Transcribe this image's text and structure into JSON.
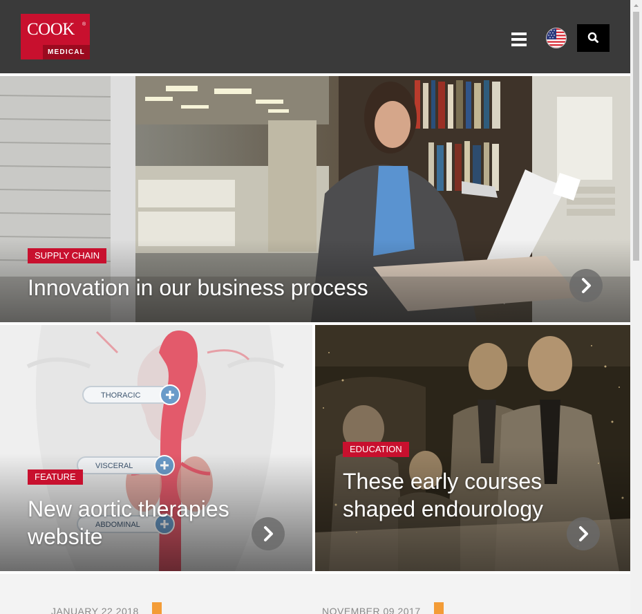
{
  "header": {
    "logo": {
      "word": "COOK",
      "sub": "MEDICAL"
    },
    "menu_icon": "hamburger-icon",
    "language_icon": "us-flag-icon",
    "search_icon": "search-icon"
  },
  "tiles": [
    {
      "tag": "SUPPLY CHAIN",
      "title": "Innovation in our business process",
      "arrow_icon": "chevron-right-icon"
    },
    {
      "tag": "FEATURE",
      "title": "New aortic therapies website",
      "arrow_icon": "chevron-right-icon",
      "diagram_labels": [
        "THORACIC",
        "VISCERAL",
        "ABDOMINAL"
      ]
    },
    {
      "tag": "EDUCATION",
      "title": "These early courses shaped endourology",
      "arrow_icon": "chevron-right-icon"
    }
  ],
  "news": [
    {
      "date": "JANUARY 22 2018",
      "icon": "bookmark-icon"
    },
    {
      "date": "NOVEMBER 09 2017",
      "icon": "bookmark-icon"
    }
  ],
  "colors": {
    "brand_red": "#c8102e",
    "header_bg": "#3a3a3a",
    "bookmark_orange": "#f39c37"
  }
}
